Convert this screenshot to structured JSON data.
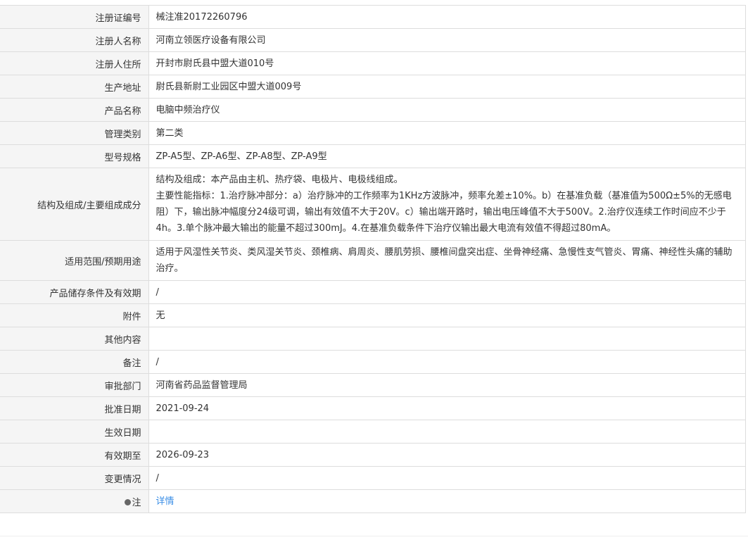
{
  "rows": [
    {
      "label": "注册证编号",
      "value": "械注准20172260796"
    },
    {
      "label": "注册人名称",
      "value": "河南立领医疗设备有限公司"
    },
    {
      "label": "注册人住所",
      "value": "开封市尉氏县中盟大道010号"
    },
    {
      "label": "生产地址",
      "value": "尉氏县新尉工业园区中盟大道009号"
    },
    {
      "label": "产品名称",
      "value": "电脑中频治疗仪"
    },
    {
      "label": "管理类别",
      "value": "第二类"
    },
    {
      "label": "型号规格",
      "value": "ZP-A5型、ZP-A6型、ZP-A8型、ZP-A9型"
    },
    {
      "label": "结构及组成/主要组成成分",
      "value_line1": "结构及组成：本产品由主机、热疗袋、电极片、电极线组成。",
      "value_line2": "主要性能指标：1.治疗脉冲部分：a）治疗脉冲的工作频率为1KHz方波脉冲，频率允差±10%。b）在基准负载（基准值为500Ω±5%的无感电阻）下，输出脉冲幅度分24级可调，输出有效值不大于20V。c）输出端开路时，输出电压峰值不大于500V。2.治疗仪连续工作时间应不少于4h。3.单个脉冲最大输出的能量不超过300mJ。4.在基准负载条件下治疗仪输出最大电流有效值不得超过80mA。"
    },
    {
      "label": "适用范围/预期用途",
      "value": "适用于风湿性关节炎、类风湿关节炎、颈椎病、肩周炎、腰肌劳损、腰椎间盘突出症、坐骨神经痛、急慢性支气管炎、胃痛、神经性头痛的辅助治疗。"
    },
    {
      "label": "产品储存条件及有效期",
      "value": "/"
    },
    {
      "label": "附件",
      "value": "无"
    },
    {
      "label": "其他内容",
      "value": ""
    },
    {
      "label": "备注",
      "value": "/"
    },
    {
      "label": "审批部门",
      "value": "河南省药品监督管理局"
    },
    {
      "label": "批准日期",
      "value": "2021-09-24"
    },
    {
      "label": "生效日期",
      "value": ""
    },
    {
      "label": "有效期至",
      "value": "2026-09-23"
    },
    {
      "label": "变更情况",
      "value": "/"
    },
    {
      "label": "注",
      "icon": "lightbulb-icon",
      "value": "详情"
    }
  ],
  "colors": {
    "label_bg": "#f5f5f5",
    "border": "#dddddd",
    "text": "#333333",
    "link": "#3a8ee6"
  }
}
